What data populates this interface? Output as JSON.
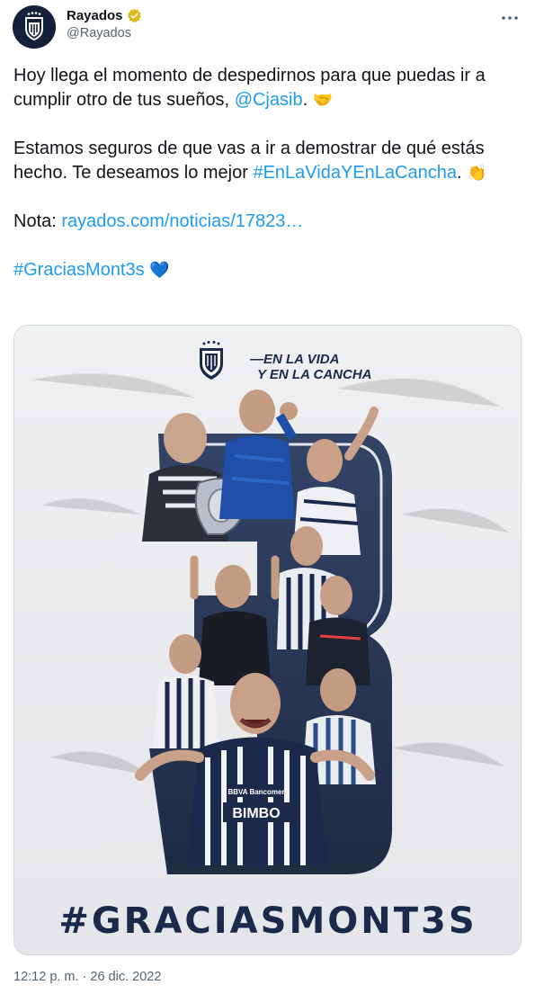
{
  "author": {
    "display_name": "Rayados",
    "handle": "@Rayados",
    "verified_icon": "verified-badge-icon"
  },
  "menu_icon": "more-options-icon",
  "tweet": {
    "para1_text": "Hoy llega el momento de despedirnos para que puedas ir a cumplir otro de tus sueños, ",
    "para1_mention": "@Cjasib",
    "para1_end": ". ",
    "para1_emoji": "🤝",
    "para2_text": "Estamos seguros de que vas a ir a demostrar de qué estás hecho. Te deseamos lo mejor ",
    "para2_hashtag": "#EnLaVidaYEnLaCancha",
    "para2_end": ". ",
    "para2_emoji": "👏",
    "para3_label": "Nota: ",
    "para3_link": "rayados.com/noticias/17823…",
    "para4_hashtag": "#GraciasMont3s",
    "para4_emoji": "💙"
  },
  "media": {
    "slogan_line1": "—EN LA VIDA",
    "slogan_line2": "Y EN LA CANCHA",
    "big_number": "3",
    "hashtag": "#GRACIASMONT3S",
    "jersey_sponsor1": "BBVA Bancomer",
    "jersey_sponsor2": "BIMBO",
    "colors": {
      "navy": "#1b2a4a",
      "blue": "#1f4fa8",
      "bg": "#eef0f2"
    }
  },
  "timestamp": "12:12 p. m. · 26 dic. 2022"
}
